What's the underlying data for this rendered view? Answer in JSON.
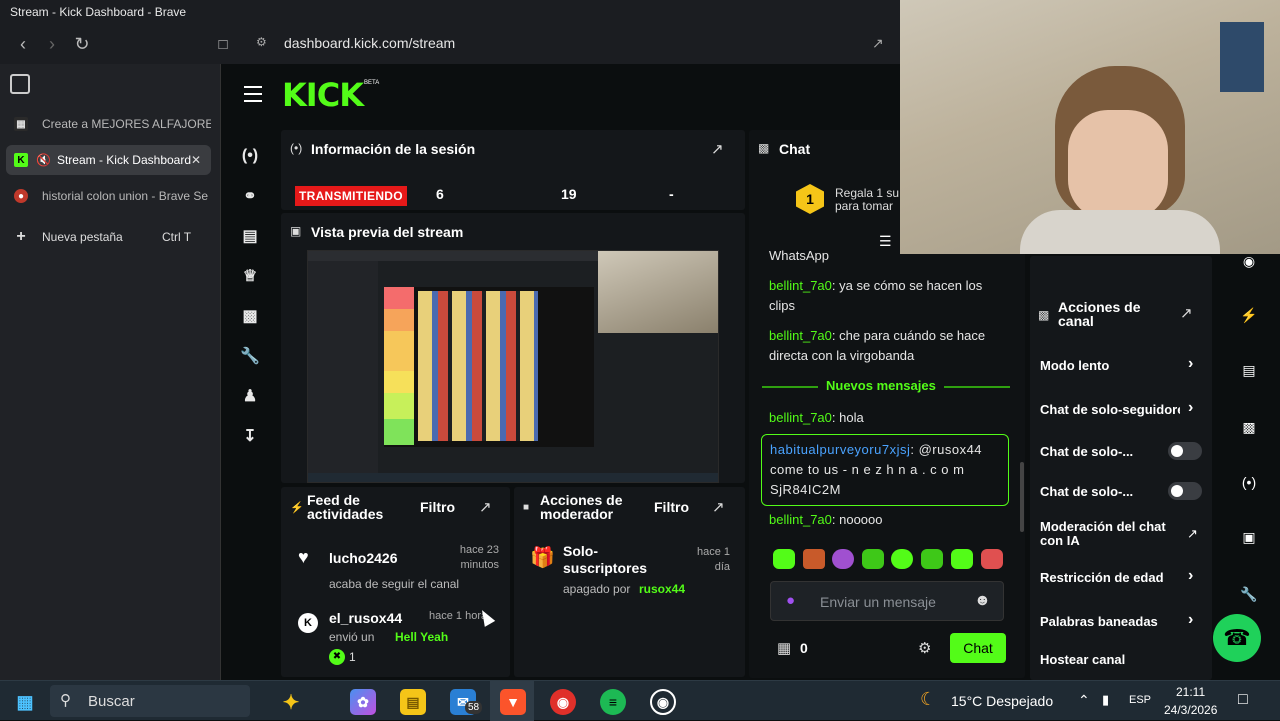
{
  "window": {
    "title": "Stream - Kick Dashboard - Brave"
  },
  "browser": {
    "url": "dashboard.kick.com/stream"
  },
  "tabs": [
    {
      "label": "Create a MEJORES ALFAJORES t"
    },
    {
      "label": "Stream - Kick Dashboard"
    },
    {
      "label": "historial colon union - Brave Se"
    },
    {
      "label": "Nueva pestaña",
      "shortcut": "Ctrl  T"
    }
  ],
  "kick": {
    "logo": "KICK",
    "beta": "BETA",
    "session": {
      "title": "Información de la sesión",
      "status": "TRANSMITIENDO",
      "stat1": "6",
      "stat2": "19",
      "stat3": "-"
    },
    "preview": {
      "title": "Vista previa del stream"
    },
    "feed": {
      "title": "Feed de actividades",
      "filter": "Filtro",
      "items": [
        {
          "user": "lucho2426",
          "time": "hace 23 minutos",
          "action": "acaba de seguir el canal"
        },
        {
          "user": "el_rusox44",
          "time": "hace 1 hora",
          "action": "envió un",
          "item": "Hell Yeah",
          "count": "1"
        }
      ]
    },
    "modactions": {
      "title": "Acciones de moderador",
      "filter": "Filtro",
      "item": {
        "title": "Solo-suscriptores",
        "time": "hace 1 día",
        "status": "apagado por",
        "user": "rusox44"
      }
    },
    "chat": {
      "title": "Chat",
      "promo": "Regala 1 su para tomar",
      "prev_line": "WhatsApp",
      "messages": [
        {
          "user": "bellint_7a0",
          "text": ": ya se cómo se hacen los clips"
        },
        {
          "user": "bellint_7a0",
          "text": ": che para cuándo se hace directa con la virgobanda"
        }
      ],
      "new_label": "Nuevos mensajes",
      "new_messages": [
        {
          "user": "bellint_7a0",
          "text": ": hola"
        },
        {
          "user": "habitualpurveyoru7xjsj",
          "text": ": @rusox44 come to us - n e z h n a . c o m SjR84IC2M"
        },
        {
          "user": "bellint_7a0",
          "text": ": nooooo"
        }
      ],
      "input_placeholder": "Enviar un mensaje",
      "points": "0",
      "send_label": "Chat"
    },
    "channel_actions": {
      "title": "Acciones de canal",
      "items": [
        {
          "label": "Modo lento"
        },
        {
          "label": "Chat de solo-seguidores"
        },
        {
          "label": "Chat de solo-..."
        },
        {
          "label": "Chat de solo-..."
        },
        {
          "label": "Moderación del chat con IA"
        },
        {
          "label": "Restricción de edad"
        },
        {
          "label": "Palabras baneadas"
        },
        {
          "label": "Hostear canal"
        }
      ]
    }
  },
  "taskbar": {
    "search": "Buscar",
    "mail_badge": "58",
    "weather": "15°C  Despejado",
    "lang": "ESP",
    "time": "21:11",
    "date": "24/3/2026"
  }
}
